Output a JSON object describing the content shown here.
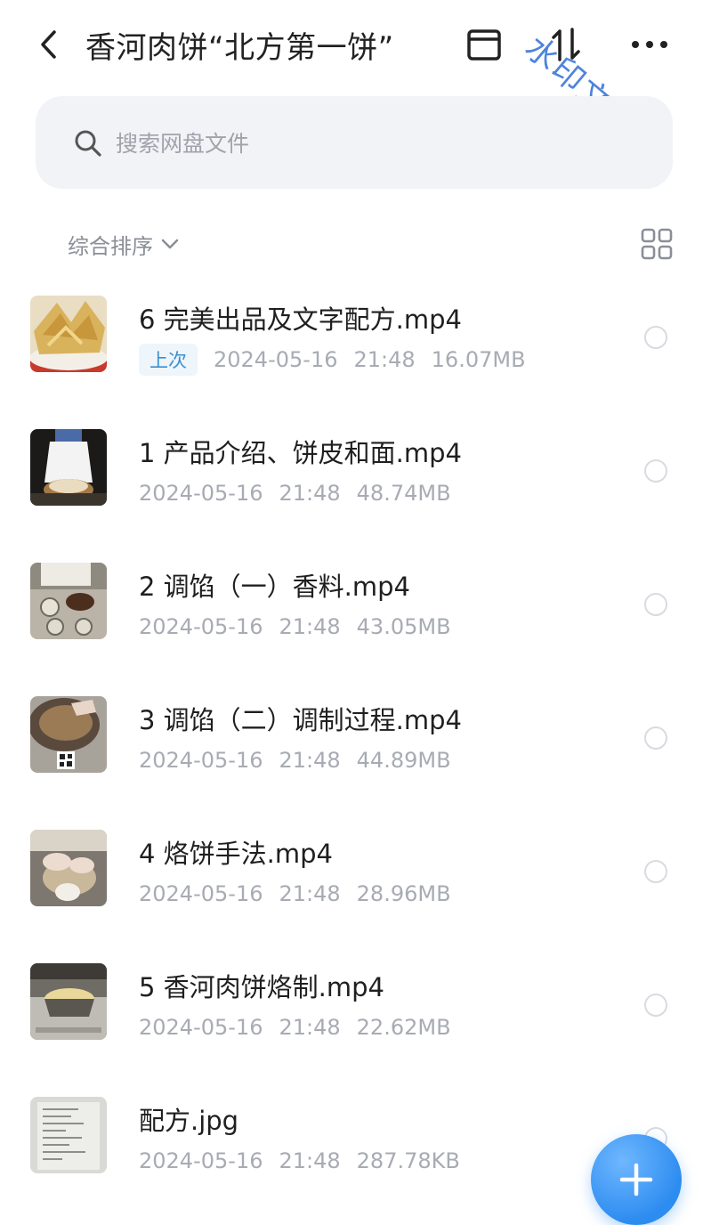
{
  "header": {
    "title": "香河肉饼“北方第一饼”",
    "watermark": "水印文字",
    "icons": [
      "back-icon",
      "archive-box-icon",
      "sort-updown-icon",
      "more-icon"
    ]
  },
  "search": {
    "placeholder": "搜索网盘文件"
  },
  "toolbar": {
    "sort_label": "综合排序",
    "view_toggle": "grid-view-icon"
  },
  "files": [
    {
      "name": "6 完美出品及文字配方.mp4",
      "badge": "上次",
      "date": "2024-05-16",
      "time": "21:48",
      "size": "16.07MB"
    },
    {
      "name": "1 产品介绍、饼皮和面.mp4",
      "badge": "",
      "date": "2024-05-16",
      "time": "21:48",
      "size": "48.74MB"
    },
    {
      "name": "2 调馅（一）香料.mp4",
      "badge": "",
      "date": "2024-05-16",
      "time": "21:48",
      "size": "43.05MB"
    },
    {
      "name": "3 调馅（二）调制过程.mp4",
      "badge": "",
      "date": "2024-05-16",
      "time": "21:48",
      "size": "44.89MB"
    },
    {
      "name": "4 烙饼手法.mp4",
      "badge": "",
      "date": "2024-05-16",
      "time": "21:48",
      "size": "28.96MB"
    },
    {
      "name": "5 香河肉饼烙制.mp4",
      "badge": "",
      "date": "2024-05-16",
      "time": "21:48",
      "size": "22.62MB"
    },
    {
      "name": "配方.jpg",
      "badge": "",
      "date": "2024-05-16",
      "time": "21:48",
      "size": "287.78KB"
    }
  ],
  "fab": {
    "icon": "plus-icon"
  },
  "colors": {
    "accent": "#2d8cf0",
    "badge_text": "#3c8fd0",
    "meta_text": "#a8abb3",
    "search_bg": "#f2f3f7"
  }
}
